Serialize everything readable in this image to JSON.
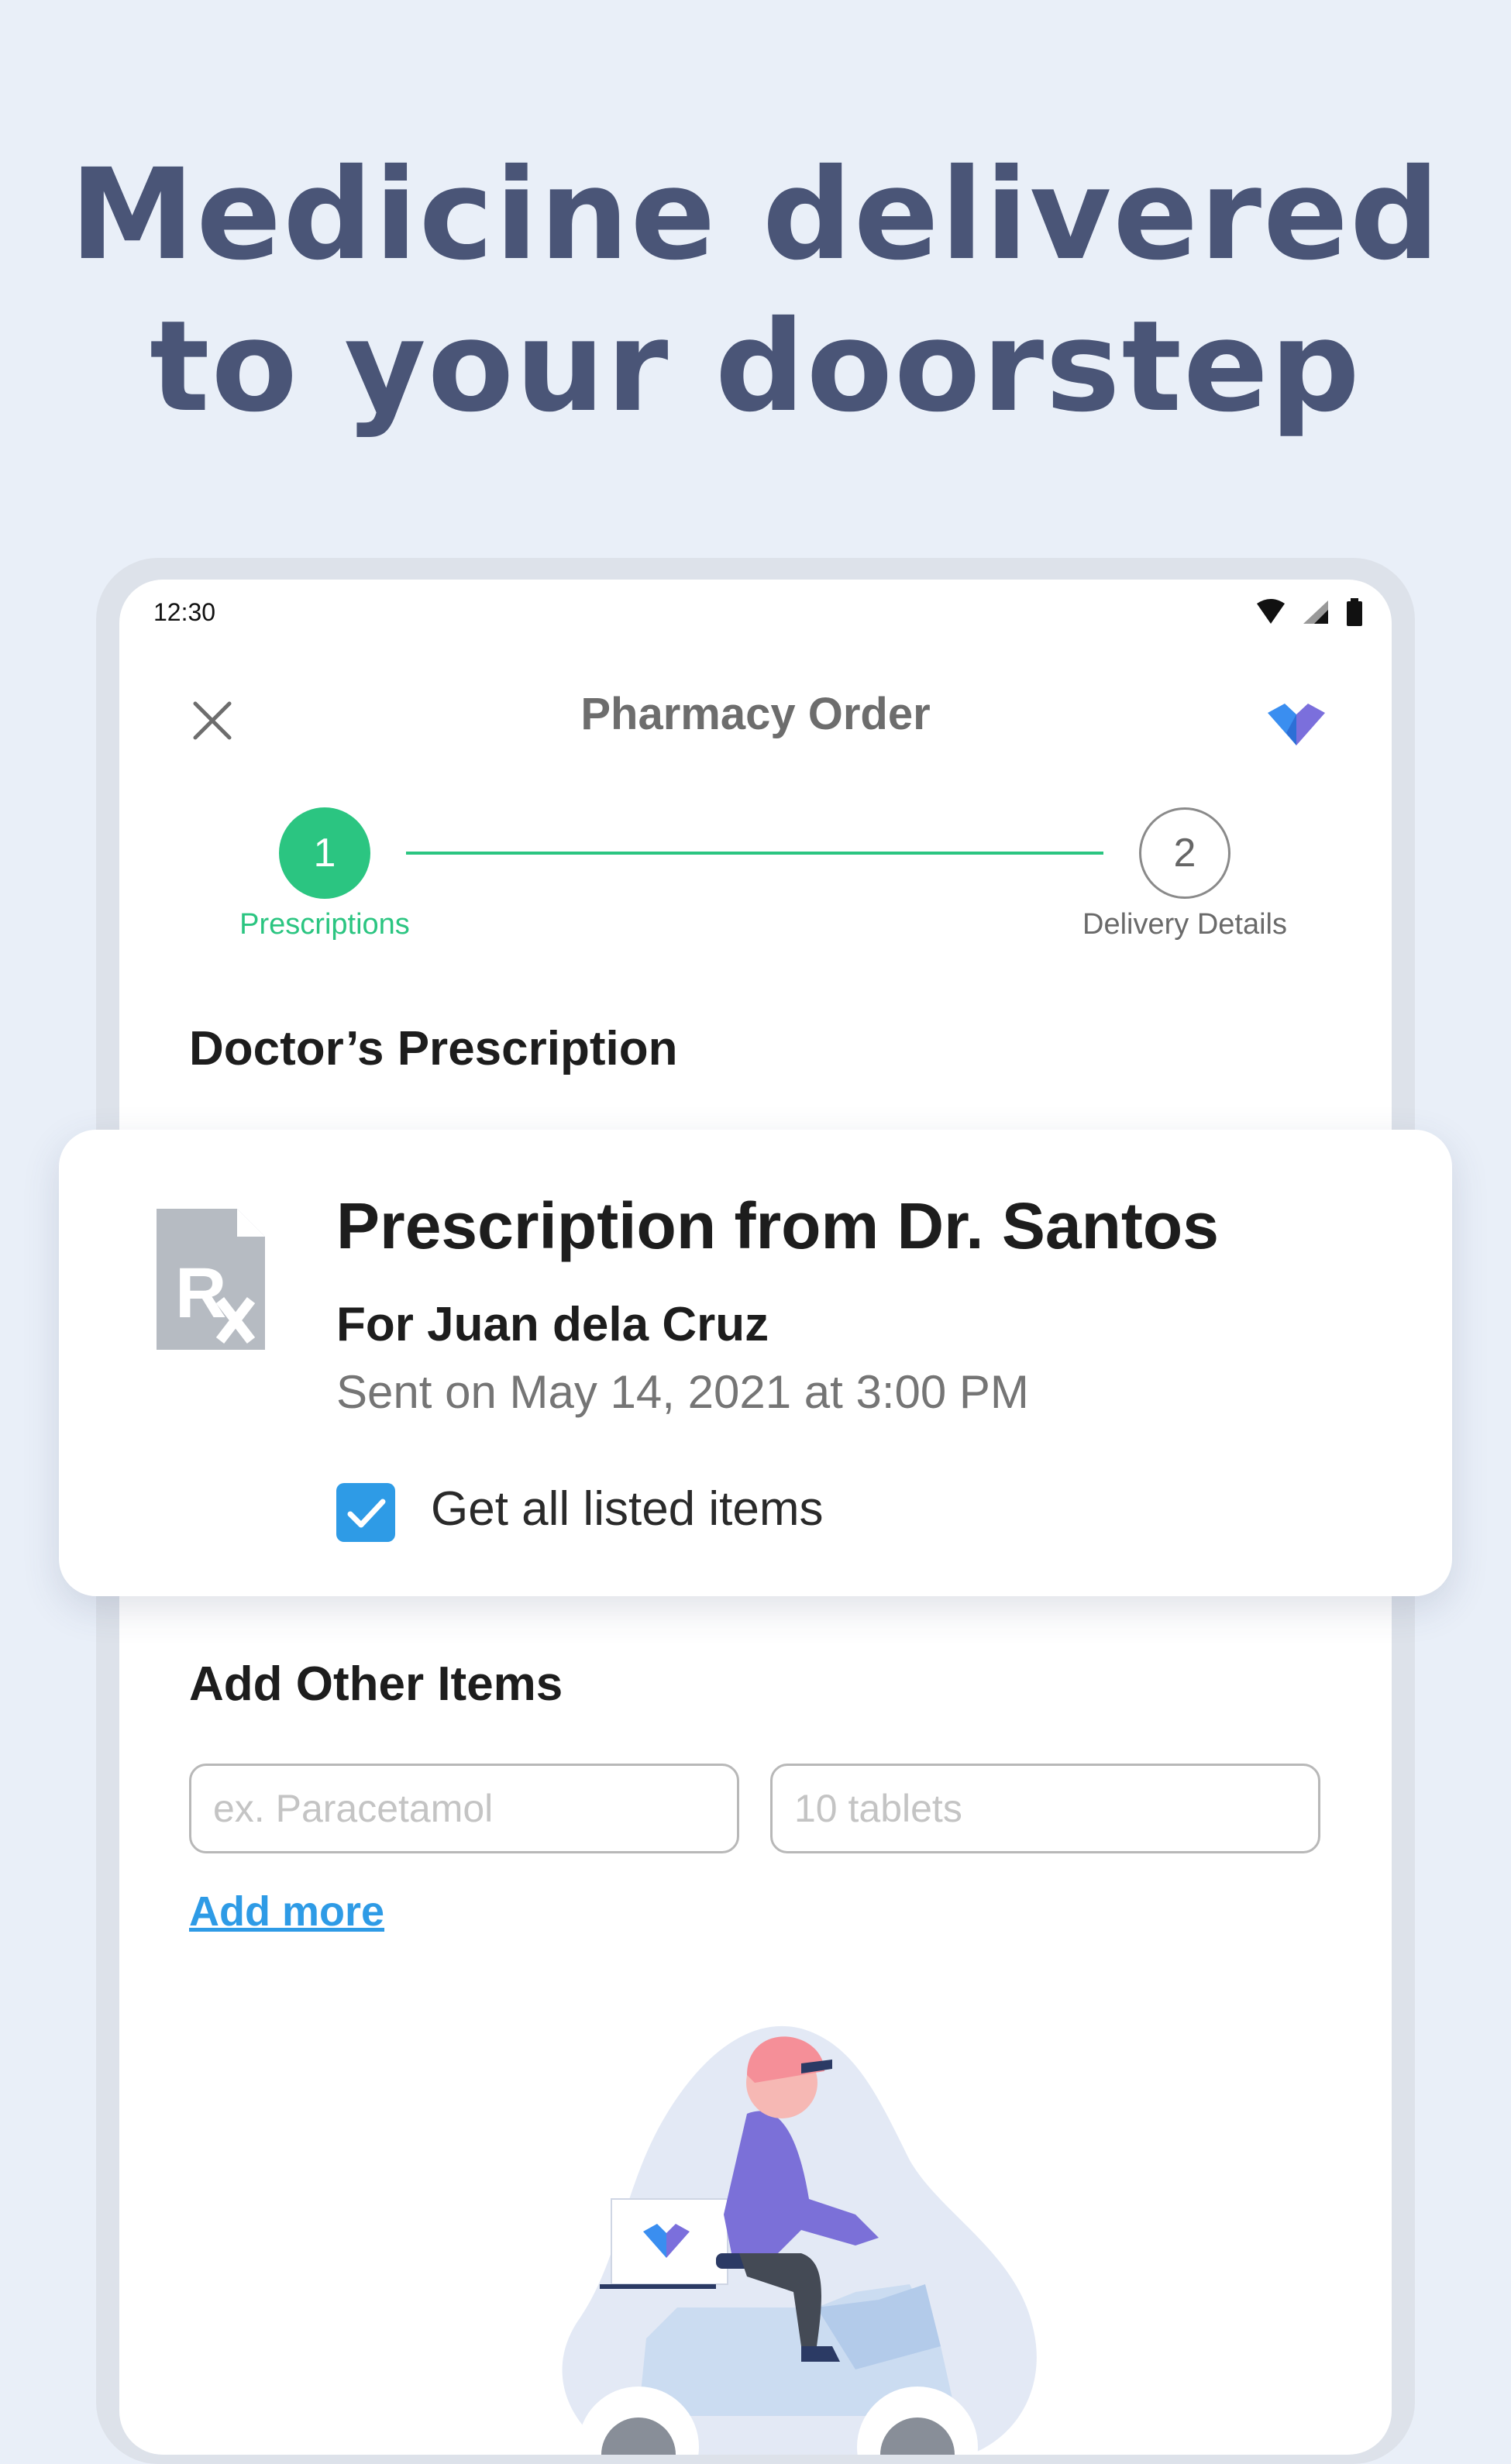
{
  "headline": {
    "line1": "Medicine delivered",
    "line2": "to your doorstep"
  },
  "status_bar": {
    "time": "12:30",
    "icons": [
      "wifi-icon",
      "cellular-signal-icon",
      "battery-icon"
    ]
  },
  "toolbar": {
    "title": "Pharmacy Order",
    "close_icon": "close-icon",
    "logo_icon": "heart-logo-icon"
  },
  "stepper": {
    "steps": [
      {
        "number": "1",
        "label": "Prescriptions",
        "state": "active"
      },
      {
        "number": "2",
        "label": "Delivery Details",
        "state": "inactive"
      }
    ]
  },
  "prescription_section": {
    "title": "Doctor’s Prescription"
  },
  "prescription_card": {
    "icon": "prescription-rx-icon",
    "title": "Prescription from Dr. Santos",
    "for_line": "For Juan dela Cruz",
    "sent_line": "Sent on May 14, 2021 at 3:00 PM",
    "checkbox_label": "Get all listed items",
    "checked": true
  },
  "other_items": {
    "title": "Add Other Items",
    "item_placeholder": "ex. Paracetamol",
    "quantity_placeholder": "10 tablets",
    "add_more_label": "Add more"
  },
  "colors": {
    "background": "#e9eff8",
    "headline": "#4a5577",
    "accent_green": "#2bc581",
    "link_blue": "#2e9be6",
    "logo_purple": "#7b6fdc",
    "logo_blue": "#3a8ef0"
  }
}
